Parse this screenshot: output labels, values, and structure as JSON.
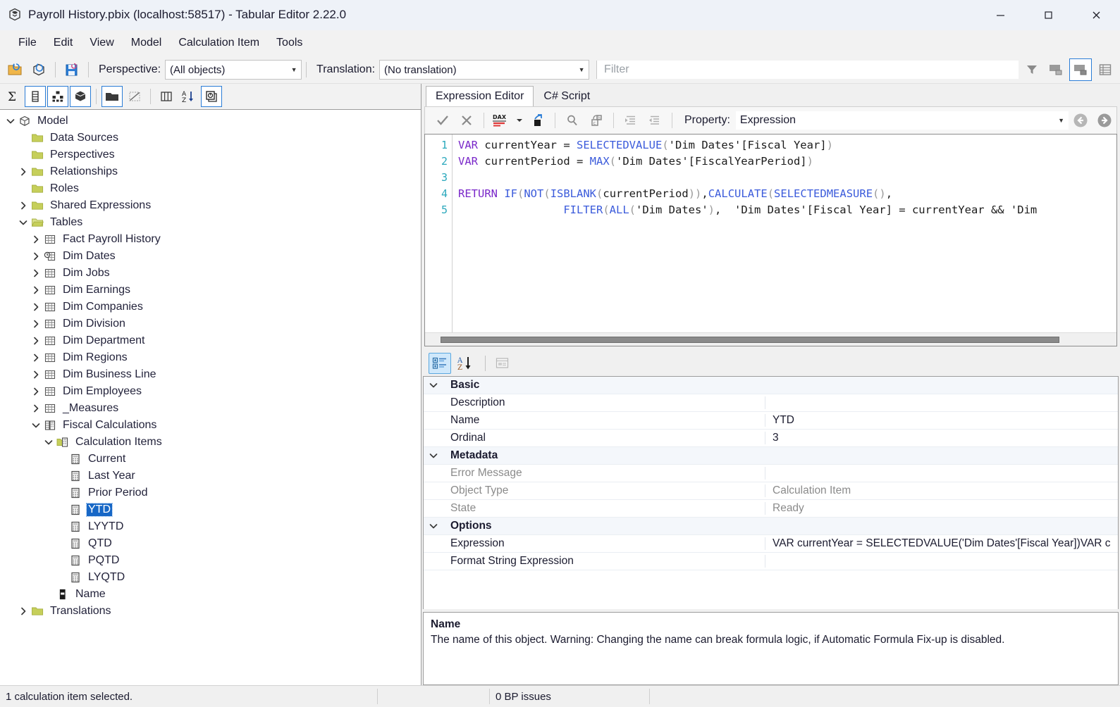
{
  "window": {
    "title": "Payroll History.pbix (localhost:58517) - Tabular Editor 2.22.0",
    "app_icon": "tabular-editor-icon",
    "minimize": "—",
    "maximize": "□",
    "close": "✕"
  },
  "menubar": {
    "items": [
      {
        "label": "File"
      },
      {
        "label": "Edit"
      },
      {
        "label": "View"
      },
      {
        "label": "Model"
      },
      {
        "label": "Calculation Item"
      },
      {
        "label": "Tools"
      }
    ]
  },
  "toolbar": {
    "open_icon": "open-folder-icon",
    "refresh_icon": "refresh-model-icon",
    "save_icon": "save-icon",
    "perspective_label": "Perspective:",
    "perspective_value": "(All objects)",
    "translation_label": "Translation:",
    "translation_value": "(No translation)",
    "filter_placeholder": "Filter",
    "filter_value": "",
    "right_icons": [
      {
        "name": "filter-funnel-icon",
        "selected": false
      },
      {
        "name": "hide-preview-pane-icon",
        "selected": false
      },
      {
        "name": "show-preview-pane-icon",
        "selected": true
      },
      {
        "name": "grid-view-icon",
        "selected": false
      }
    ]
  },
  "explorer_toolbar": {
    "icons": [
      {
        "name": "sigma-measures-icon",
        "selected": false
      },
      {
        "name": "columns-icon",
        "selected": true
      },
      {
        "name": "hierarchies-icon",
        "selected": true
      },
      {
        "name": "partitions-icon",
        "selected": true
      },
      {
        "name": "display-folders-icon",
        "selected": true
      },
      {
        "name": "hidden-objects-icon",
        "selected": false
      },
      {
        "name": "all-columns-icon",
        "selected": false
      },
      {
        "name": "sort-alpha-icon",
        "selected": false
      },
      {
        "name": "calculation-groups-icon",
        "selected": true
      }
    ]
  },
  "tree": {
    "nodes": [
      {
        "label": "Model",
        "depth": 0,
        "twist": "expanded",
        "icon": "model-cube-icon",
        "selected": false
      },
      {
        "label": "Data Sources",
        "depth": 1,
        "twist": "none",
        "icon": "folder-icon",
        "selected": false
      },
      {
        "label": "Perspectives",
        "depth": 1,
        "twist": "none",
        "icon": "folder-icon",
        "selected": false
      },
      {
        "label": "Relationships",
        "depth": 1,
        "twist": "collapsed",
        "icon": "folder-icon",
        "selected": false
      },
      {
        "label": "Roles",
        "depth": 1,
        "twist": "none",
        "icon": "folder-icon",
        "selected": false
      },
      {
        "label": "Shared Expressions",
        "depth": 1,
        "twist": "collapsed",
        "icon": "folder-icon",
        "selected": false
      },
      {
        "label": "Tables",
        "depth": 1,
        "twist": "expanded",
        "icon": "folder-open-icon",
        "selected": false
      },
      {
        "label": "Fact Payroll History",
        "depth": 2,
        "twist": "collapsed",
        "icon": "table-icon",
        "selected": false
      },
      {
        "label": "Dim Dates",
        "depth": 2,
        "twist": "collapsed",
        "icon": "date-table-icon",
        "selected": false
      },
      {
        "label": "Dim Jobs",
        "depth": 2,
        "twist": "collapsed",
        "icon": "table-icon",
        "selected": false
      },
      {
        "label": "Dim Earnings",
        "depth": 2,
        "twist": "collapsed",
        "icon": "table-icon",
        "selected": false
      },
      {
        "label": "Dim Companies",
        "depth": 2,
        "twist": "collapsed",
        "icon": "table-icon",
        "selected": false
      },
      {
        "label": "Dim Division",
        "depth": 2,
        "twist": "collapsed",
        "icon": "table-icon",
        "selected": false
      },
      {
        "label": "Dim Department",
        "depth": 2,
        "twist": "collapsed",
        "icon": "table-icon",
        "selected": false
      },
      {
        "label": "Dim Regions",
        "depth": 2,
        "twist": "collapsed",
        "icon": "table-icon",
        "selected": false
      },
      {
        "label": "Dim Business Line",
        "depth": 2,
        "twist": "collapsed",
        "icon": "table-icon",
        "selected": false
      },
      {
        "label": "Dim Employees",
        "depth": 2,
        "twist": "collapsed",
        "icon": "table-icon",
        "selected": false
      },
      {
        "label": "_Measures",
        "depth": 2,
        "twist": "collapsed",
        "icon": "table-icon",
        "selected": false
      },
      {
        "label": "Fiscal Calculations",
        "depth": 2,
        "twist": "expanded",
        "icon": "calc-group-icon",
        "selected": false
      },
      {
        "label": "Calculation Items",
        "depth": 3,
        "twist": "expanded",
        "icon": "calc-items-folder-icon",
        "selected": false
      },
      {
        "label": "Current",
        "depth": 4,
        "twist": "none",
        "icon": "calc-item-icon",
        "selected": false
      },
      {
        "label": "Last Year",
        "depth": 4,
        "twist": "none",
        "icon": "calc-item-icon",
        "selected": false
      },
      {
        "label": "Prior Period",
        "depth": 4,
        "twist": "none",
        "icon": "calc-item-icon",
        "selected": false
      },
      {
        "label": "YTD",
        "depth": 4,
        "twist": "none",
        "icon": "calc-item-icon",
        "selected": true
      },
      {
        "label": "LYYTD",
        "depth": 4,
        "twist": "none",
        "icon": "calc-item-icon",
        "selected": false
      },
      {
        "label": "QTD",
        "depth": 4,
        "twist": "none",
        "icon": "calc-item-icon",
        "selected": false
      },
      {
        "label": "PQTD",
        "depth": 4,
        "twist": "none",
        "icon": "calc-item-icon",
        "selected": false
      },
      {
        "label": "LYQTD",
        "depth": 4,
        "twist": "none",
        "icon": "calc-item-icon",
        "selected": false
      },
      {
        "label": "Name",
        "depth": 3,
        "twist": "none",
        "icon": "column-icon",
        "selected": false
      },
      {
        "label": "Translations",
        "depth": 1,
        "twist": "collapsed",
        "icon": "folder-icon",
        "selected": false
      }
    ]
  },
  "tabs": [
    {
      "label": "Expression Editor",
      "active": true
    },
    {
      "label": "C# Script",
      "active": false
    }
  ],
  "editor_toolbar": {
    "accept_icon": "check-accept-icon",
    "cancel_icon": "cross-cancel-icon",
    "dax_format_icon": "dax-formatter-icon",
    "dax_caret_icon": "chevron-down-icon",
    "goto_icon": "goto-object-icon",
    "find_icon": "search-magnifier-icon",
    "replace_icon": "find-replace-icon",
    "indent_icon": "increase-indent-icon",
    "outdent_icon": "decrease-indent-icon",
    "property_label": "Property:",
    "property_value": "Expression",
    "nav_back_icon": "navigate-back-icon",
    "nav_forward_icon": "navigate-forward-icon"
  },
  "code": {
    "line_numbers": [
      "1",
      "2",
      "3",
      "4",
      "5"
    ],
    "lines": [
      [
        {
          "t": "VAR",
          "c": "k-kw"
        },
        {
          "t": " currentYear ",
          "c": "k-id"
        },
        {
          "t": "= ",
          "c": "k-id"
        },
        {
          "t": "SELECTEDVALUE",
          "c": "k-fn"
        },
        {
          "t": "(",
          "c": "k-par"
        },
        {
          "t": "'Dim Dates'[Fiscal Year]",
          "c": "k-id"
        },
        {
          "t": ")",
          "c": "k-par"
        }
      ],
      [
        {
          "t": "VAR",
          "c": "k-kw"
        },
        {
          "t": " currentPeriod ",
          "c": "k-id"
        },
        {
          "t": "= ",
          "c": "k-id"
        },
        {
          "t": "MAX",
          "c": "k-fn"
        },
        {
          "t": "(",
          "c": "k-par"
        },
        {
          "t": "'Dim Dates'[FiscalYearPeriod]",
          "c": "k-id"
        },
        {
          "t": ")",
          "c": "k-par"
        }
      ],
      [],
      [
        {
          "t": "RETURN ",
          "c": "k-kw"
        },
        {
          "t": "IF",
          "c": "k-fn"
        },
        {
          "t": "(",
          "c": "k-par"
        },
        {
          "t": "NOT",
          "c": "k-fn"
        },
        {
          "t": "(",
          "c": "k-par"
        },
        {
          "t": "ISBLANK",
          "c": "k-fn"
        },
        {
          "t": "(",
          "c": "k-par"
        },
        {
          "t": "currentPeriod",
          "c": "k-id"
        },
        {
          "t": "))",
          "c": "k-par"
        },
        {
          "t": ",",
          "c": "k-id"
        },
        {
          "t": "CALCULATE",
          "c": "k-fn"
        },
        {
          "t": "(",
          "c": "k-par"
        },
        {
          "t": "SELECTEDMEASURE",
          "c": "k-fn"
        },
        {
          "t": "()",
          "c": "k-par"
        },
        {
          "t": ",",
          "c": "k-id"
        }
      ],
      [
        {
          "t": "                ",
          "c": "k-id"
        },
        {
          "t": "FILTER",
          "c": "k-fn"
        },
        {
          "t": "(",
          "c": "k-par"
        },
        {
          "t": "ALL",
          "c": "k-fn"
        },
        {
          "t": "(",
          "c": "k-par"
        },
        {
          "t": "'Dim Dates'",
          "c": "k-id"
        },
        {
          "t": ")",
          "c": "k-par"
        },
        {
          "t": ",  ",
          "c": "k-id"
        },
        {
          "t": "'Dim Dates'[Fiscal Year] = currentYear && 'Dim",
          "c": "k-id"
        }
      ]
    ]
  },
  "property_grid": {
    "toolbar": {
      "categorized_icon": "categorized-view-icon",
      "alphabetical_icon": "alphabetical-sort-icon",
      "property_pages_icon": "property-pages-icon"
    },
    "rows": [
      {
        "kind": "category",
        "name": "Basic",
        "value": "",
        "dim": false
      },
      {
        "kind": "prop",
        "name": "Description",
        "value": "",
        "dim": false
      },
      {
        "kind": "prop",
        "name": "Name",
        "value": "YTD",
        "dim": false
      },
      {
        "kind": "prop",
        "name": "Ordinal",
        "value": "3",
        "dim": false
      },
      {
        "kind": "category",
        "name": "Metadata",
        "value": "",
        "dim": false
      },
      {
        "kind": "prop",
        "name": "Error Message",
        "value": "",
        "dim": true
      },
      {
        "kind": "prop",
        "name": "Object Type",
        "value": "Calculation Item",
        "dim": true
      },
      {
        "kind": "prop",
        "name": "State",
        "value": "Ready",
        "dim": true
      },
      {
        "kind": "category",
        "name": "Options",
        "value": "",
        "dim": false
      },
      {
        "kind": "prop",
        "name": "Expression",
        "value": "VAR currentYear = SELECTEDVALUE('Dim Dates'[Fiscal Year])VAR c",
        "dim": false
      },
      {
        "kind": "prop",
        "name": "Format String Expression",
        "value": "",
        "dim": false
      }
    ],
    "description": {
      "title": "Name",
      "body": "The name of this object. Warning: Changing the name can break formula logic, if Automatic Formula Fix-up is disabled."
    }
  },
  "statusbar": {
    "selection": "1 calculation item selected.",
    "cell2": "",
    "bp_issues": "0 BP issues",
    "cell4": ""
  },
  "colors": {
    "accent_blue": "#1767c6",
    "selection_blue": "#2b7dd6",
    "folder_yellow": "#c6cf5a",
    "titlebar_bg": "#eef2f8",
    "toolbar_bg": "#f2f2f2",
    "keyword_purple": "#7a28c9",
    "function_blue": "#3b5bdb",
    "linenumber_teal": "#2aa8bc"
  }
}
